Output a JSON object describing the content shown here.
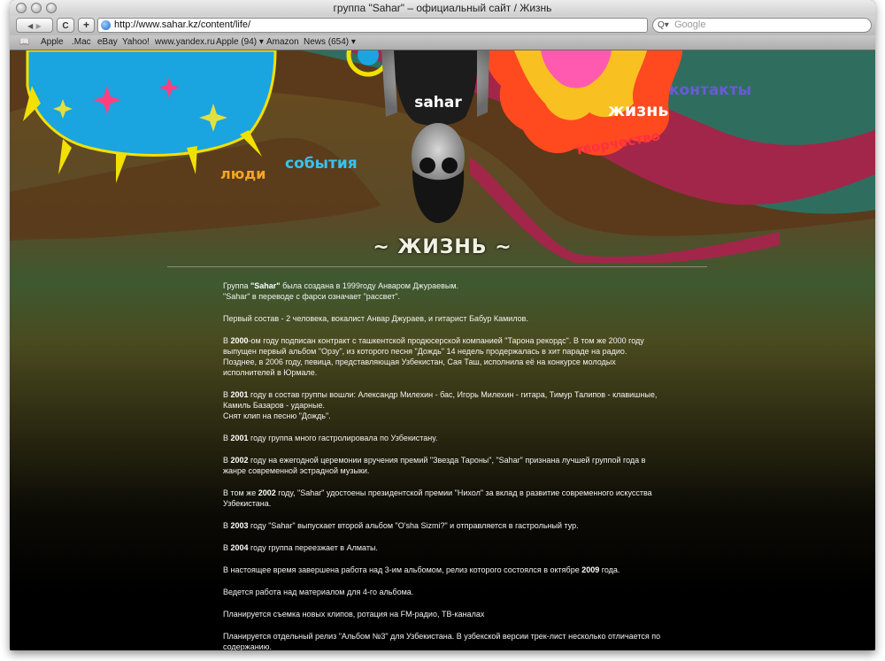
{
  "window": {
    "title": "группа \"Sahar\" – официальный сайт / Жизнь"
  },
  "toolbar": {
    "back_glyph": "◀",
    "forward_glyph": "▶",
    "reload_glyph": "C",
    "add_glyph": "+"
  },
  "address": {
    "url": "http://www.sahar.kz/content/life/"
  },
  "search": {
    "placeholder": "Google",
    "icon_glyph": "Q▾"
  },
  "bookmarks": {
    "icon_glyph": "📖",
    "items": [
      "Apple",
      ".Mac",
      "eBay",
      "Yahoo!",
      "www.yandex.ru",
      "Apple (94) ▾",
      "Amazon",
      "News (654) ▾"
    ]
  },
  "nav": {
    "people": "люди",
    "events": "события",
    "life": "жизнь",
    "creativity": "творчество",
    "contacts": "контакты"
  },
  "logo": {
    "text": "sahar"
  },
  "page": {
    "heading": "~ ЖИЗНЬ ~"
  },
  "colors": {
    "blue_splash": "#1aa4e0",
    "red_wave": "#a0244a",
    "teal_wave": "#2a7a6a",
    "nav_orange": "#f4a624",
    "nav_cyan": "#38c2f0",
    "nav_red": "#ff3040",
    "nav_violet": "#6a5ad8"
  },
  "article": [
    [
      {
        "t": "Группа "
      },
      {
        "t": "\"Sahar\"",
        "b": true
      },
      {
        "t": " была создана в 1999году Анваром Джураевым."
      },
      {
        "br": true
      },
      {
        "t": "\"Sahar\" в переводе с фарси означает \"рассвет\"."
      }
    ],
    [
      {
        "t": "Первый состав - 2 человека, вокалист Анвар Джураев, и гитарист Бабур Камилов."
      }
    ],
    [
      {
        "t": "В "
      },
      {
        "t": "2000",
        "b": true
      },
      {
        "t": "-ом году подписан контракт с ташкентской продюсерской компанией \"Тарона рекордс\". В том же 2000 году выпущен первый альбом \"Орзу\", из которого песня \"Дождь\" 14 недель продержалась в хит параде на радио. Позднее, в 2006 году, певица, представляющая Узбекистан, Сая Таш, исполнила её на конкурсе молодых исполнителей в Юрмале."
      }
    ],
    [
      {
        "t": "В "
      },
      {
        "t": "2001",
        "b": true
      },
      {
        "t": " году в состав группы вошли: Александр Милехин - бас, Игорь Милехин - гитара, Тимур Талипов - клавишные, Камиль Базаров - ударные."
      },
      {
        "br": true
      },
      {
        "t": "Снят клип на песню \"Дождь\"."
      }
    ],
    [
      {
        "t": "В "
      },
      {
        "t": "2001",
        "b": true
      },
      {
        "t": " году группа много гастролировала по Узбекистану."
      }
    ],
    [
      {
        "t": "В "
      },
      {
        "t": "2002",
        "b": true
      },
      {
        "t": " году на ежегодной церемонии вручения премий \"Звезда Тароны\", \"Sahar\" признана лучшей группой года в жанре современной эстрадной музыки."
      }
    ],
    [
      {
        "t": "В том же "
      },
      {
        "t": "2002",
        "b": true
      },
      {
        "t": " году, \"Sahar\" удостоены президентской премии \"Нихол\" за вклад в развитие современного искусства Узбекистана."
      }
    ],
    [
      {
        "t": "В "
      },
      {
        "t": "2003",
        "b": true
      },
      {
        "t": " году \"Sahar\" выпускает второй альбом \"O'sha Sizmi?\" и отправляется в гастрольный тур."
      }
    ],
    [
      {
        "t": "В "
      },
      {
        "t": "2004",
        "b": true
      },
      {
        "t": " году группа переезжает в Алматы."
      }
    ],
    [
      {
        "t": "В настоящее время завершена работа над 3-им альбомом, релиз которого состоялся в октябре "
      },
      {
        "t": "2009",
        "b": true
      },
      {
        "t": " года."
      }
    ],
    [
      {
        "t": "Ведется работа над материалом для 4-го альбома."
      }
    ],
    [
      {
        "t": "Планируется съемка новых клипов, ротация на FM-радио, ТВ-каналах"
      }
    ],
    [
      {
        "t": "Планируется отдельный релиз \"Альбом №3\" для Узбекистана. В узбекской версии трек-лист несколько отличается по содержанию."
      }
    ]
  ]
}
